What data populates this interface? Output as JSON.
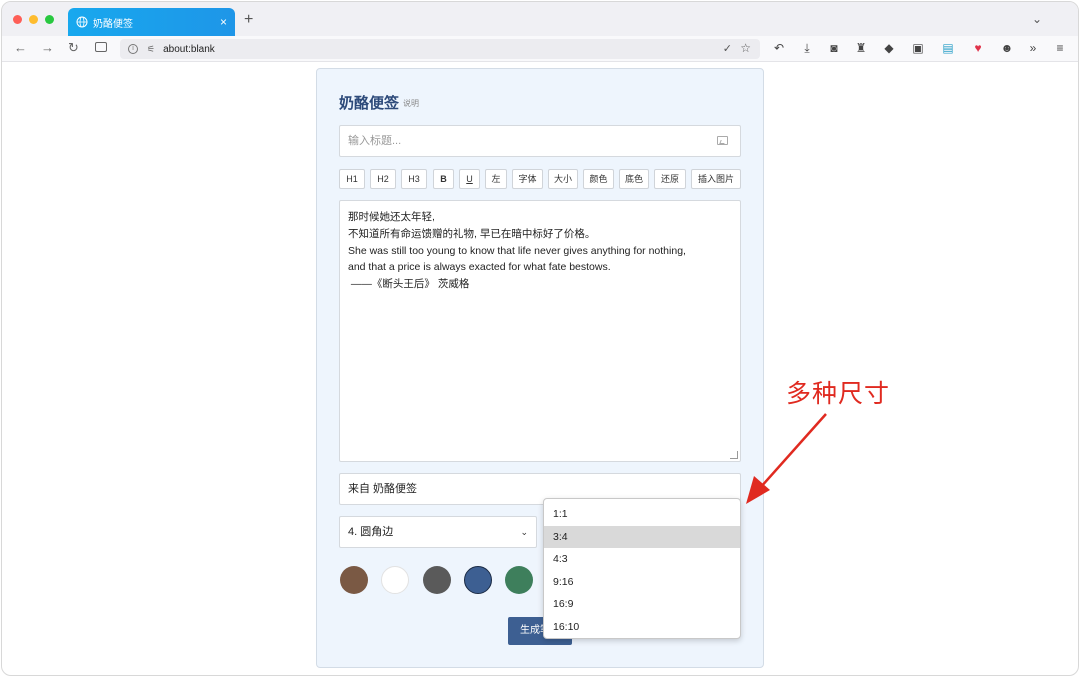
{
  "browser": {
    "tab_title": "奶酪便签",
    "tab_close": "×",
    "new_tab": "+",
    "url": "about:blank"
  },
  "app": {
    "title": "奶酪便签",
    "help_link": "说明",
    "title_placeholder": "输入标题...",
    "format_buttons": [
      "H1",
      "H2",
      "H3",
      "B",
      "U",
      "左",
      "字体",
      "大小",
      "颜色",
      "底色",
      "还原",
      "插入图片"
    ],
    "editor_lines": [
      "那时候她还太年轻,",
      "不知道所有命运馈赠的礼物, 早已在暗中标好了价格。",
      "",
      "She was still too young to know that life never gives anything for nothing,",
      "and that a price is always exacted for what fate bestows.",
      "",
      " ——《断头王后》 茨威格"
    ],
    "source_text": "来自 奶酪便签",
    "style_select_value": "4. 圆角边",
    "color_swatches": [
      "#7a5944",
      "#ffffff",
      "#5a5a5a",
      "#3d5f92",
      "#3e7f5c"
    ],
    "selected_swatch_index": 3,
    "generate_button": "生成笔记",
    "size_options": [
      "1:1",
      "3:4",
      "4:3",
      "9:16",
      "16:9",
      "16:10"
    ],
    "size_highlighted": "3:4"
  },
  "annotation": {
    "text": "多种尺寸",
    "color": "#e02a20"
  }
}
